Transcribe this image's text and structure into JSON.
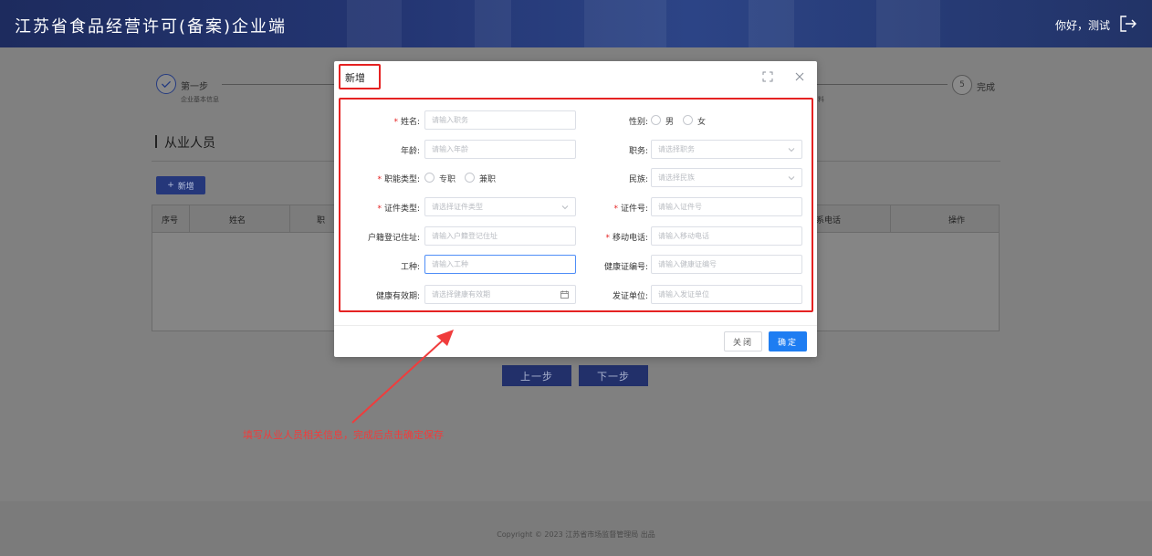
{
  "header": {
    "title": "江苏省食品经营许可(备案)企业端",
    "user_greeting": "你好，测试"
  },
  "steps": [
    {
      "index": "✓",
      "title": "第一步",
      "desc": "企业基本信息"
    },
    {
      "index": "5",
      "title": "完成",
      "desc": ""
    }
  ],
  "hidden_step_fragment": "料",
  "section": {
    "title": "从业人员"
  },
  "toolbar": {
    "add_label": "新增",
    "add_icon": "+"
  },
  "table": {
    "columns": [
      "序号",
      "姓名",
      "职",
      "联系电话",
      "操作"
    ]
  },
  "nav": {
    "prev_label": "上一步",
    "next_label": "下一步"
  },
  "annotation": "填写从业人员相关信息，完成后点击确定保存",
  "footer": {
    "text": "Copyright © 2023 江苏省市场监督管理局 出品"
  },
  "modal": {
    "title": "新增",
    "fields": {
      "name": {
        "label": "姓名:",
        "placeholder": "请输入职务",
        "required": true
      },
      "gender": {
        "label": "性别:",
        "options": [
          "男",
          "女"
        ]
      },
      "age": {
        "label": "年龄:",
        "placeholder": "请输入年龄"
      },
      "position": {
        "label": "职务:",
        "placeholder": "请选择职务"
      },
      "job_type": {
        "label": "职能类型:",
        "options": [
          "专职",
          "兼职"
        ],
        "required": true
      },
      "ethnicity": {
        "label": "民族:",
        "placeholder": "请选择民族"
      },
      "id_type": {
        "label": "证件类型:",
        "placeholder": "请选择证件类型",
        "required": true
      },
      "id_number": {
        "label": "证件号:",
        "placeholder": "请输入证件号",
        "required": true
      },
      "household_address": {
        "label": "户籍登记住址:",
        "placeholder": "请输入户籍登记住址"
      },
      "mobile": {
        "label": "移动电话:",
        "placeholder": "请输入移动电话",
        "required": true
      },
      "work_type": {
        "label": "工种:",
        "placeholder": "请输入工种"
      },
      "health_cert_no": {
        "label": "健康证编号:",
        "placeholder": "请输入健康证编号"
      },
      "health_valid": {
        "label": "健康有效期:",
        "placeholder": "请选择健康有效期"
      },
      "issuer": {
        "label": "发证单位:",
        "placeholder": "请输入发证单位"
      }
    },
    "close_label": "关闭",
    "confirm_label": "确定"
  },
  "colors": {
    "header_bg": "#243673",
    "primary": "#1e7df2",
    "highlight_red": "#e52222",
    "nav_button": "#22306a"
  }
}
